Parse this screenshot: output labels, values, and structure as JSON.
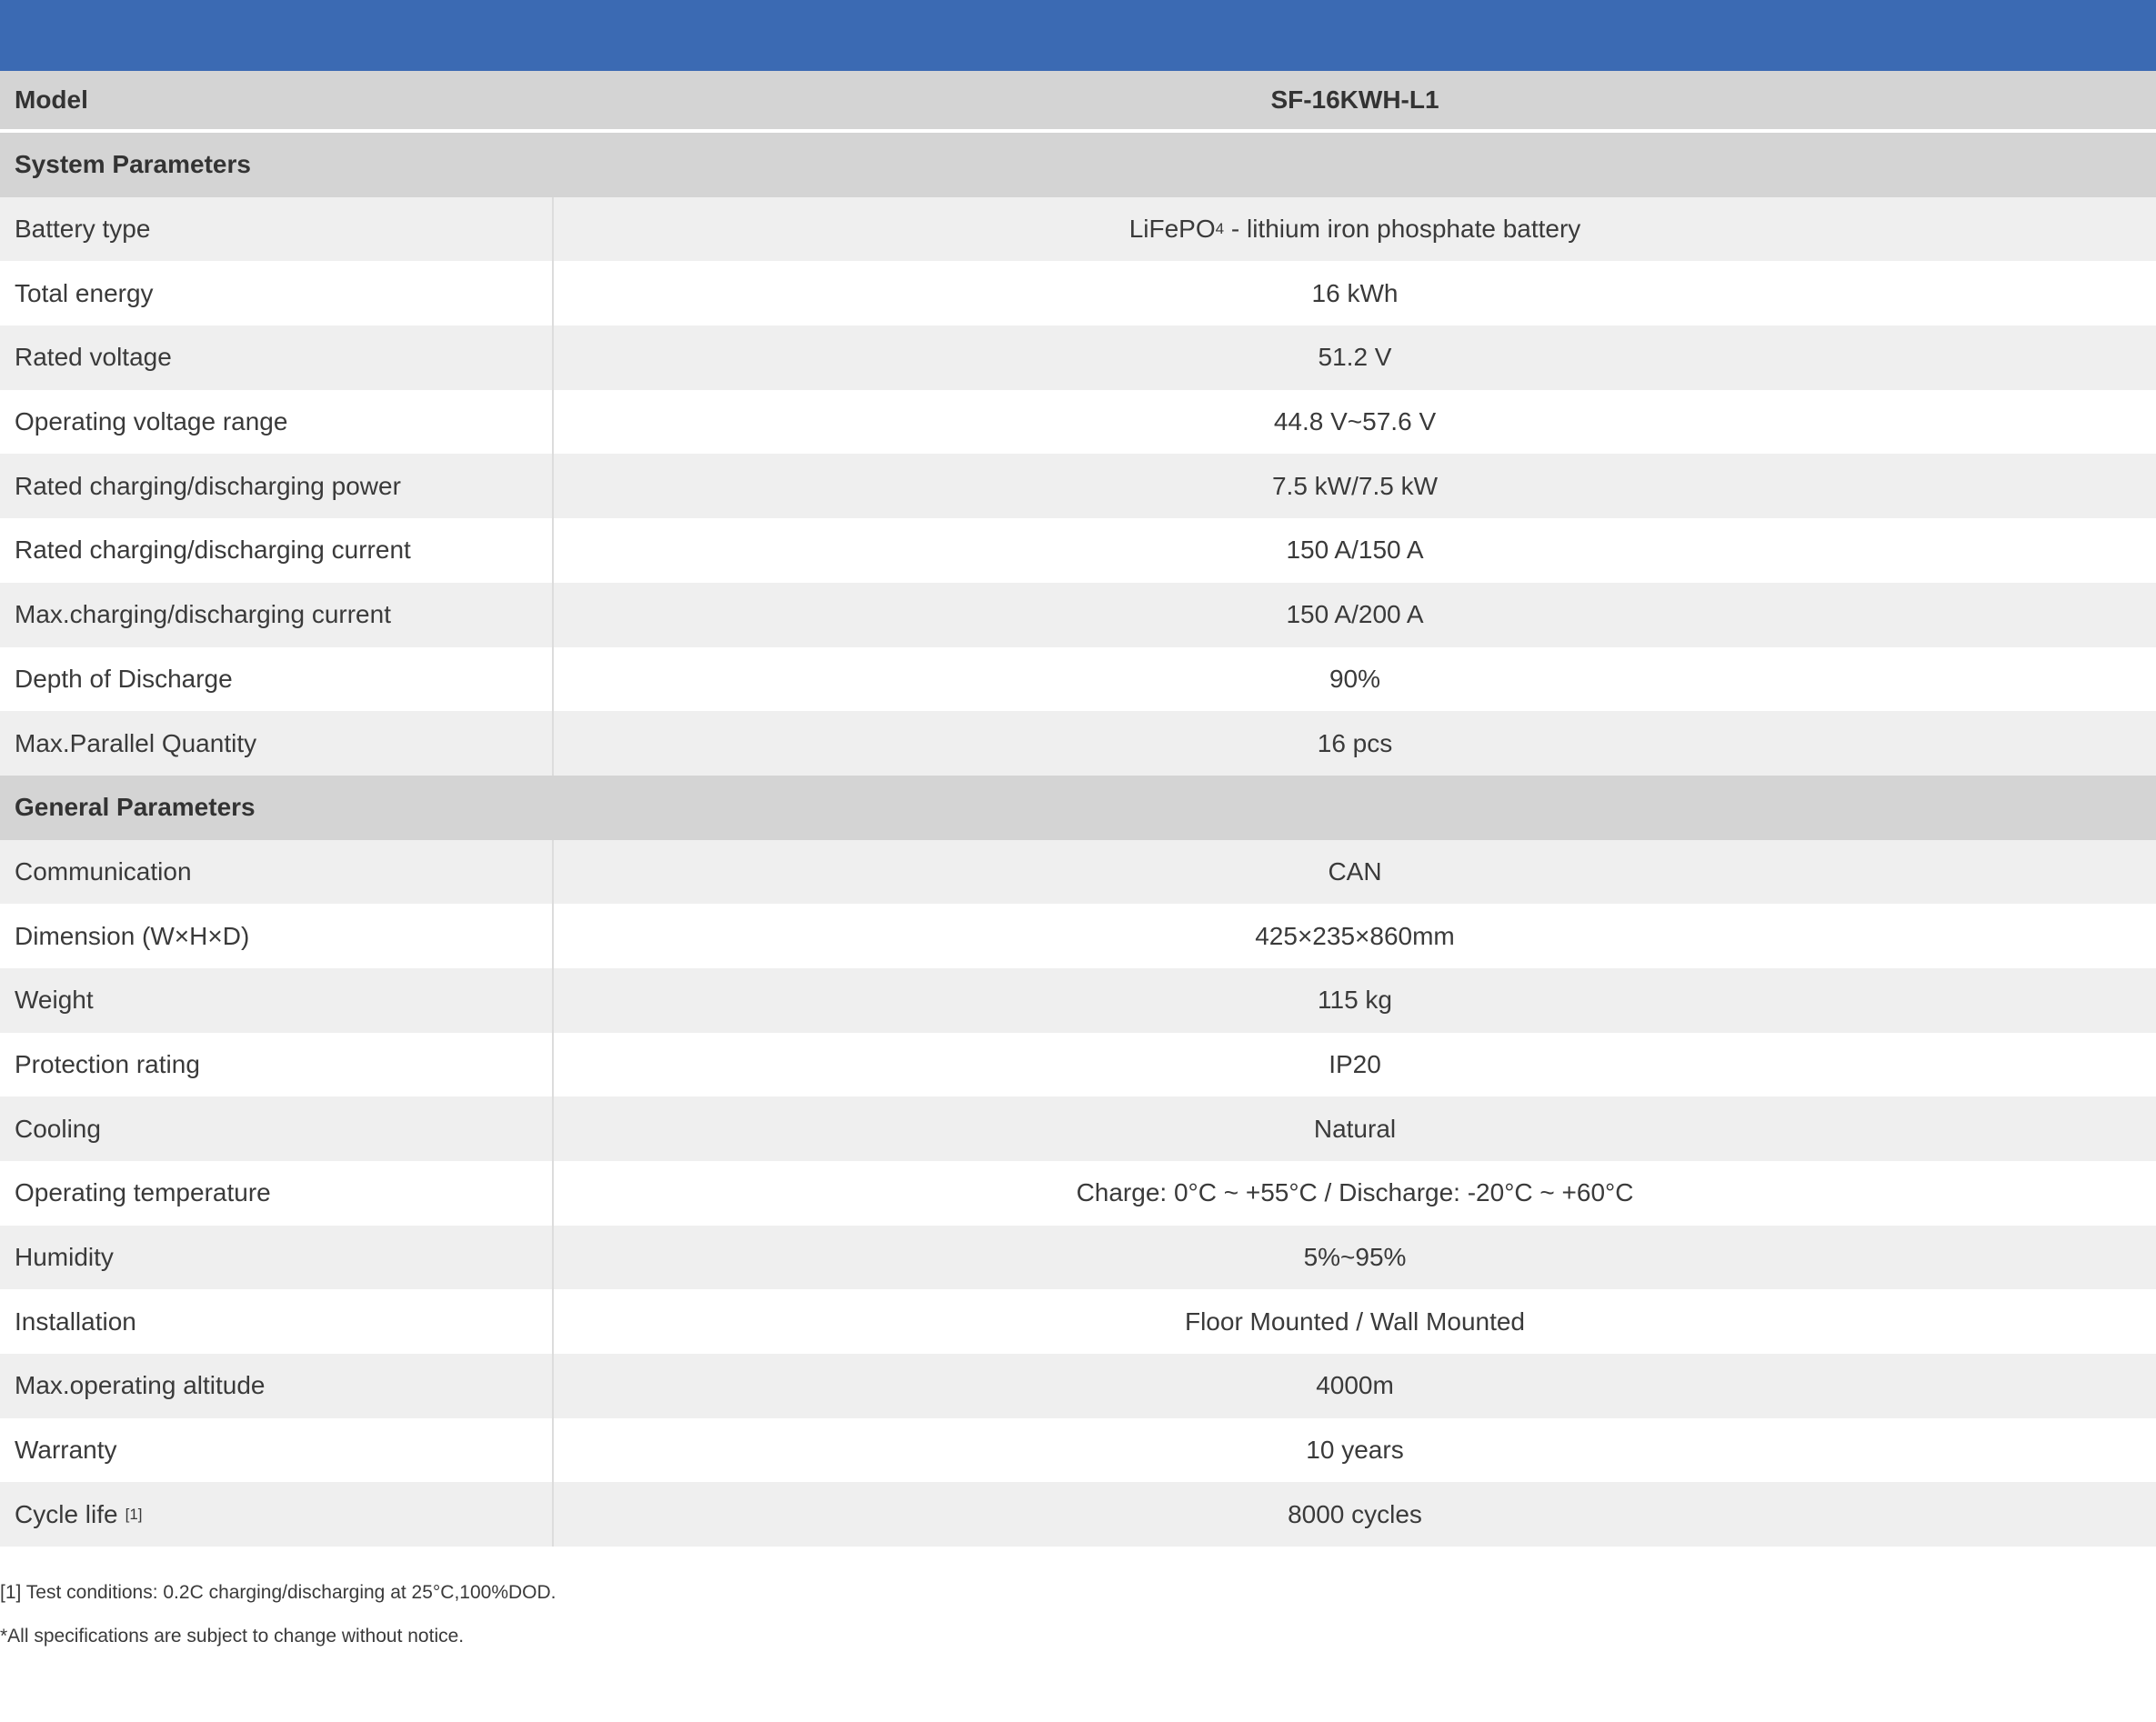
{
  "header": {
    "band_color": "#3b6ab3"
  },
  "table": {
    "model_label": "Model",
    "model_value": "SF-16KWH-L1",
    "system_section": "System Parameters",
    "battery_type_label": "Battery type",
    "battery_type_value_pre": "LiFePO",
    "battery_type_value_sub": "4",
    "battery_type_value_post": " - lithium iron phosphate battery",
    "system_rows": [
      {
        "label": "Total energy",
        "value": "16 kWh"
      },
      {
        "label": "Rated voltage",
        "value": "51.2 V"
      },
      {
        "label": "Operating voltage range",
        "value": "44.8 V~57.6 V"
      },
      {
        "label": "Rated charging/discharging power",
        "value": "7.5 kW/7.5 kW"
      },
      {
        "label": "Rated charging/discharging current",
        "value": "150 A/150 A"
      },
      {
        "label": "Max.charging/discharging current",
        "value": "150 A/200 A"
      },
      {
        "label": "Depth of Discharge",
        "value": "90%"
      },
      {
        "label": "Max.Parallel Quantity",
        "value": "16 pcs"
      }
    ],
    "general_section": "General Parameters",
    "general_rows": [
      {
        "label": "Communication",
        "value": "CAN"
      },
      {
        "label": "Dimension (W×H×D)",
        "value": "425×235×860mm"
      },
      {
        "label": "Weight",
        "value": "115 kg"
      },
      {
        "label": "Protection rating",
        "value": "IP20"
      },
      {
        "label": "Cooling",
        "value": "Natural"
      },
      {
        "label": "Operating temperature",
        "value": "Charge: 0°C ~ +55°C / Discharge: -20°C ~ +60°C"
      },
      {
        "label": "Humidity",
        "value": "5%~95%"
      },
      {
        "label": "Installation",
        "value": "Floor Mounted / Wall Mounted"
      },
      {
        "label": "Max.operating altitude",
        "value": "4000m"
      },
      {
        "label": "Warranty",
        "value": "10 years"
      }
    ],
    "cycle_life_label": "Cycle life",
    "cycle_life_note_mark": "[1]",
    "cycle_life_value": "8000 cycles"
  },
  "footnotes": {
    "note_1": "[1] Test conditions: 0.2C charging/discharging at 25°C,100%DOD.",
    "disclaimer": "*All specifications are subject to change without notice."
  }
}
